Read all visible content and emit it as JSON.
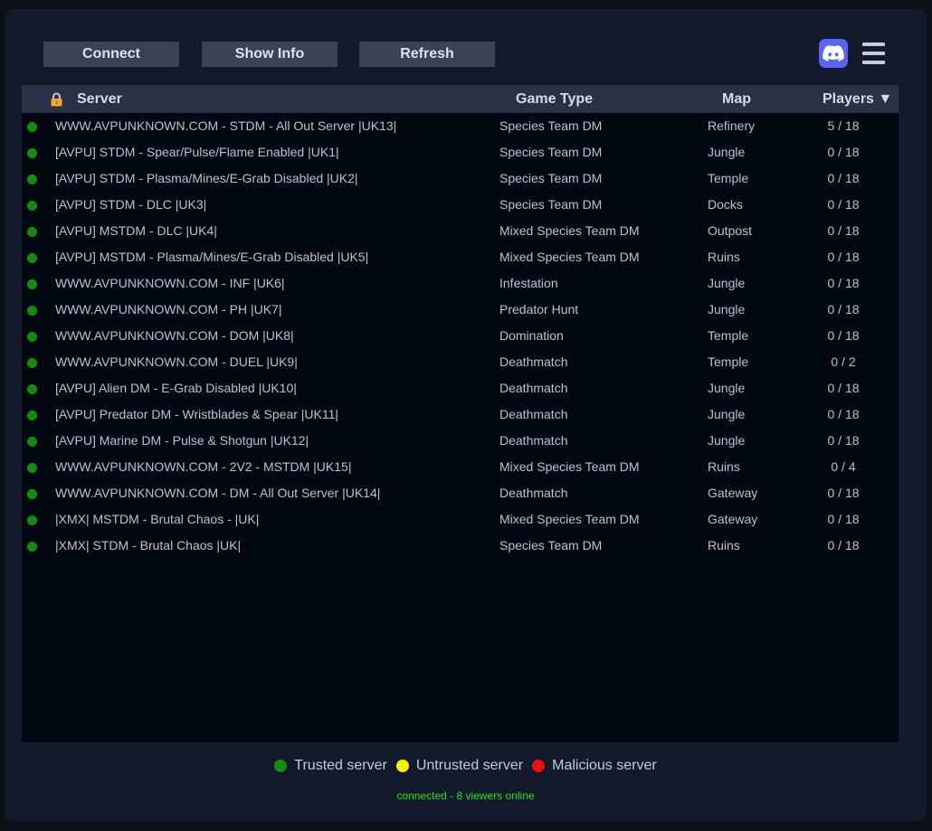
{
  "toolbar": {
    "connect_label": "Connect",
    "show_info_label": "Show Info",
    "refresh_label": "Refresh",
    "discord_icon": "discord-icon",
    "menu_icon": "hamburger-menu-icon"
  },
  "table": {
    "headers": {
      "lock_icon": "lock-icon",
      "server": "Server",
      "game_type": "Game Type",
      "map": "Map",
      "players": "Players ▼"
    },
    "rows": [
      {
        "server": "WWW.AVPUNKNOWN.COM - STDM - All Out Server |UK13|",
        "game_type": "Species Team DM",
        "map": "Refinery",
        "players": "5 / 18",
        "status": "trusted"
      },
      {
        "server": "[AVPU] STDM - Spear/Pulse/Flame Enabled |UK1|",
        "game_type": "Species Team DM",
        "map": "Jungle",
        "players": "0 / 18",
        "status": "trusted"
      },
      {
        "server": "[AVPU] STDM - Plasma/Mines/E-Grab Disabled |UK2|",
        "game_type": "Species Team DM",
        "map": "Temple",
        "players": "0 / 18",
        "status": "trusted"
      },
      {
        "server": "[AVPU] STDM - DLC |UK3|",
        "game_type": "Species Team DM",
        "map": "Docks",
        "players": "0 / 18",
        "status": "trusted"
      },
      {
        "server": "[AVPU] MSTDM - DLC |UK4|",
        "game_type": "Mixed Species Team DM",
        "map": "Outpost",
        "players": "0 / 18",
        "status": "trusted"
      },
      {
        "server": "[AVPU] MSTDM - Plasma/Mines/E-Grab Disabled |UK5|",
        "game_type": "Mixed Species Team DM",
        "map": "Ruins",
        "players": "0 / 18",
        "status": "trusted"
      },
      {
        "server": "WWW.AVPUNKNOWN.COM - INF |UK6|",
        "game_type": "Infestation",
        "map": "Jungle",
        "players": "0 / 18",
        "status": "trusted"
      },
      {
        "server": "WWW.AVPUNKNOWN.COM - PH |UK7|",
        "game_type": "Predator Hunt",
        "map": "Jungle",
        "players": "0 / 18",
        "status": "trusted"
      },
      {
        "server": "WWW.AVPUNKNOWN.COM - DOM |UK8|",
        "game_type": "Domination",
        "map": "Temple",
        "players": "0 / 18",
        "status": "trusted"
      },
      {
        "server": "WWW.AVPUNKNOWN.COM - DUEL |UK9|",
        "game_type": "Deathmatch",
        "map": "Temple",
        "players": "0 / 2",
        "status": "trusted"
      },
      {
        "server": "[AVPU] Alien DM - E-Grab Disabled |UK10|",
        "game_type": "Deathmatch",
        "map": "Jungle",
        "players": "0 / 18",
        "status": "trusted"
      },
      {
        "server": "[AVPU] Predator DM - Wristblades & Spear |UK11|",
        "game_type": "Deathmatch",
        "map": "Jungle",
        "players": "0 / 18",
        "status": "trusted"
      },
      {
        "server": "[AVPU] Marine DM - Pulse & Shotgun |UK12|",
        "game_type": "Deathmatch",
        "map": "Jungle",
        "players": "0 / 18",
        "status": "trusted"
      },
      {
        "server": "WWW.AVPUNKNOWN.COM - 2V2 - MSTDM |UK15|",
        "game_type": "Mixed Species Team DM",
        "map": "Ruins",
        "players": "0 / 4",
        "status": "trusted"
      },
      {
        "server": "WWW.AVPUNKNOWN.COM - DM - All Out Server |UK14|",
        "game_type": "Deathmatch",
        "map": "Gateway",
        "players": "0 / 18",
        "status": "trusted"
      },
      {
        "server": "|XMX| MSTDM - Brutal Chaos - |UK|",
        "game_type": "Mixed Species Team DM",
        "map": "Gateway",
        "players": "0 / 18",
        "status": "trusted"
      },
      {
        "server": "|XMX| STDM - Brutal Chaos |UK|",
        "game_type": "Species Team DM",
        "map": "Ruins",
        "players": "0 / 18",
        "status": "trusted"
      }
    ]
  },
  "legend": [
    {
      "label": "Trusted server",
      "color": "#0f8f0f"
    },
    {
      "label": "Untrusted server",
      "color": "#f2f20f"
    },
    {
      "label": "Malicious server",
      "color": "#e81212"
    }
  ],
  "status_text": "connected - 8 viewers online",
  "colors": {
    "trusted": "#0f8f0f",
    "untrusted": "#f2f20f",
    "malicious": "#e81212",
    "discord": "#5865f2",
    "status_text": "#1de51d"
  }
}
